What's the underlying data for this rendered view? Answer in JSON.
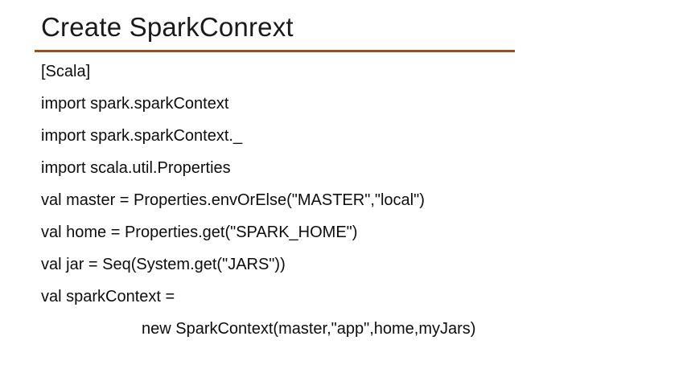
{
  "slide": {
    "title": "Create SparkConrext",
    "code_lines": [
      "[Scala]",
      "import spark.sparkContext",
      "import spark.sparkContext._",
      "import scala.util.Properties",
      "val master = Properties.envOrElse(\"MASTER\",\"local\")",
      "val home = Properties.get(\"SPARK_HOME\")",
      "val jar = Seq(System.get(\"JARS\"))",
      "val sparkContext =",
      "new SparkContext(master,\"app\",home,myJars)"
    ],
    "colors": {
      "rule": "#9b4e1c",
      "text": "#0d0d0d"
    }
  }
}
